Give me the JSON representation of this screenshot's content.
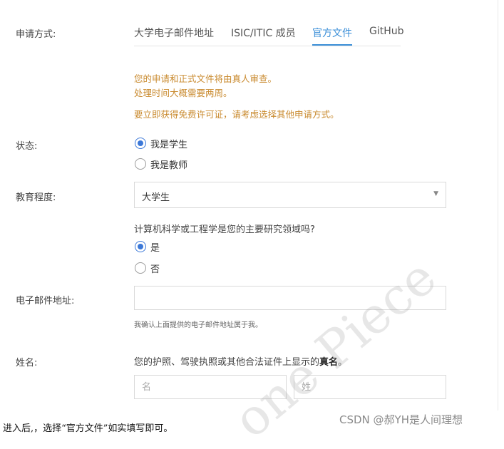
{
  "form": {
    "apply_method_label": "申请方式:",
    "tabs": [
      {
        "label": "大学电子邮件地址",
        "active": false
      },
      {
        "label": "ISIC/ITIC 成员",
        "active": false
      },
      {
        "label": "官方文件",
        "active": true
      },
      {
        "label": "GitHub",
        "active": false
      }
    ],
    "notice": {
      "line1": "您的申请和正式文件将由真人审查。",
      "line2": "处理时间大概需要两周。",
      "line3": "要立即获得免费许可证，请考虑选择其他申请方式。"
    },
    "status": {
      "label": "状态:",
      "options": [
        {
          "label": "我是学生",
          "checked": true
        },
        {
          "label": "我是教师",
          "checked": false
        }
      ]
    },
    "education": {
      "label": "教育程度:",
      "selected": "大学生",
      "arrow": "▼"
    },
    "cs_question": {
      "text": "计算机科学或工程学是您的主要研究领域吗?",
      "options": [
        {
          "label": "是",
          "checked": true
        },
        {
          "label": "否",
          "checked": false
        }
      ]
    },
    "email": {
      "label": "电子邮件地址:",
      "value": "",
      "hint": "我确认上面提供的电子邮件地址属于我。"
    },
    "name": {
      "label": "姓名:",
      "desc_prefix": "您的护照、驾驶执照或其他合法证件上显示的",
      "desc_bold": "真名",
      "desc_suffix": "。",
      "first_placeholder": "名",
      "last_placeholder": "姓"
    }
  },
  "caption": "进入后,，选择“官方文件”如实填写即可。",
  "credit": "CSDN @郝YH是人间理想",
  "watermark": "one Piece",
  "colors": {
    "accent": "#3b8fd8",
    "notice": "#c98a2e",
    "radio": "#3b78d8"
  }
}
